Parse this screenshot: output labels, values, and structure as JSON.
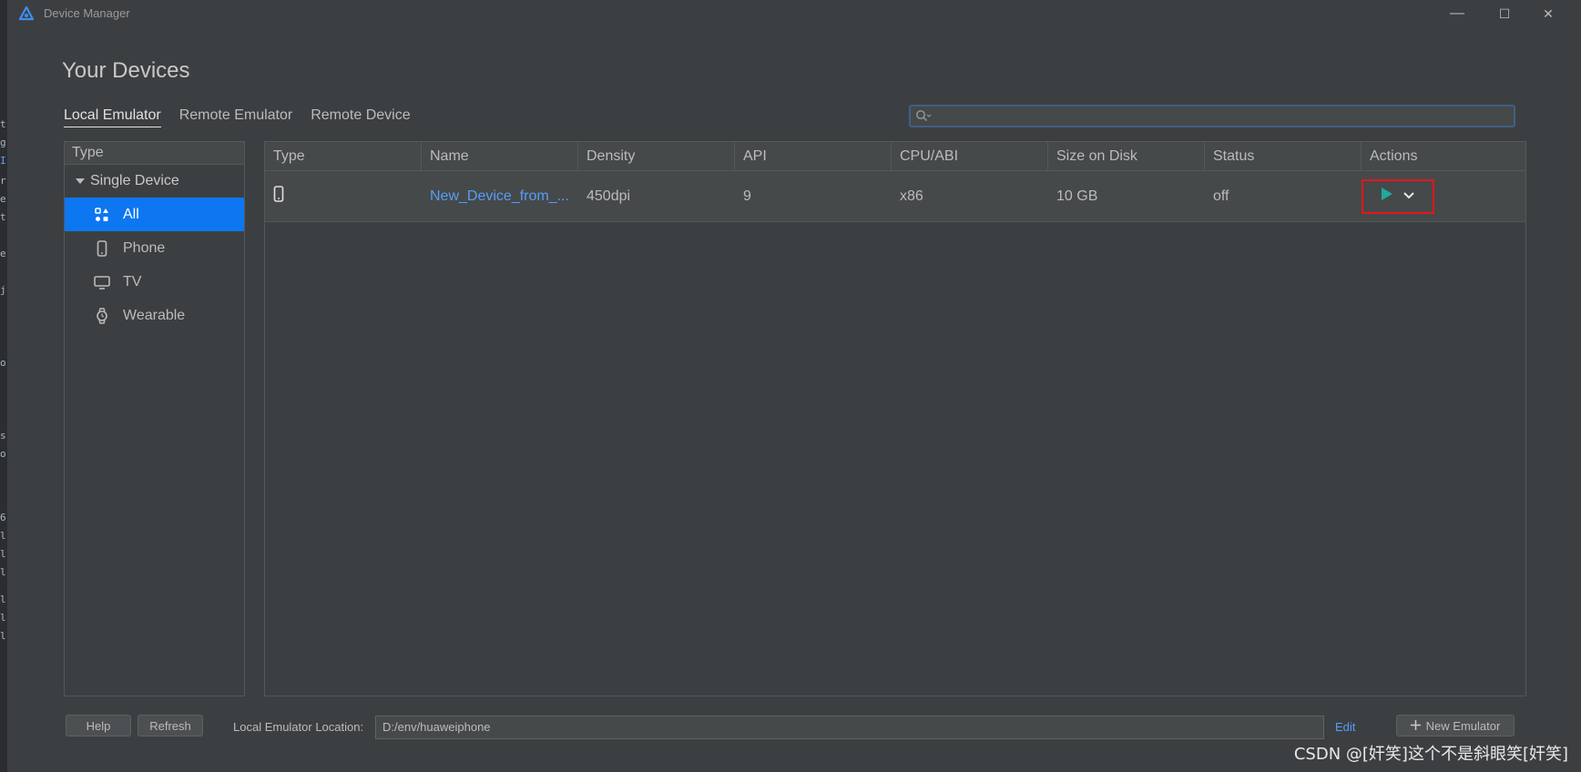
{
  "window": {
    "title": "Device Manager",
    "minimize_label": "—",
    "maximize_label": "☐",
    "close_label": "✕"
  },
  "heading": "Your Devices",
  "tabs": [
    {
      "label": "Local Emulator",
      "active": true
    },
    {
      "label": "Remote Emulator",
      "active": false
    },
    {
      "label": "Remote Device",
      "active": false
    }
  ],
  "search": {
    "placeholder": "",
    "value": "",
    "icon": "search-icon"
  },
  "left_panel": {
    "header": "Type",
    "group": "Single Device",
    "items": [
      {
        "label": "All",
        "icon": "grid-icon",
        "selected": true
      },
      {
        "label": "Phone",
        "icon": "phone-icon",
        "selected": false
      },
      {
        "label": "TV",
        "icon": "tv-icon",
        "selected": false
      },
      {
        "label": "Wearable",
        "icon": "watch-icon",
        "selected": false
      }
    ]
  },
  "table": {
    "columns": [
      "Type",
      "Name",
      "Density",
      "API",
      "CPU/ABI",
      "Size on Disk",
      "Status",
      "Actions"
    ],
    "rows": [
      {
        "type_icon": "phone-icon",
        "name": "New_Device_from_...",
        "density": "450dpi",
        "api": "9",
        "cpu": "x86",
        "size": "10 GB",
        "status": "off"
      }
    ]
  },
  "bottom": {
    "help": "Help",
    "refresh": "Refresh",
    "location_label": "Local Emulator Location:",
    "location_value": "D:/env/huaweiphone",
    "edit": "Edit",
    "new_emulator": "New Emulator"
  },
  "watermark": "CSDN @[奸笑]这个不是斜眼笑[奸笑]",
  "colors": {
    "accent": "#0d77f2",
    "link": "#589df6",
    "play": "#21a99b",
    "highlight": "#e8151b"
  }
}
